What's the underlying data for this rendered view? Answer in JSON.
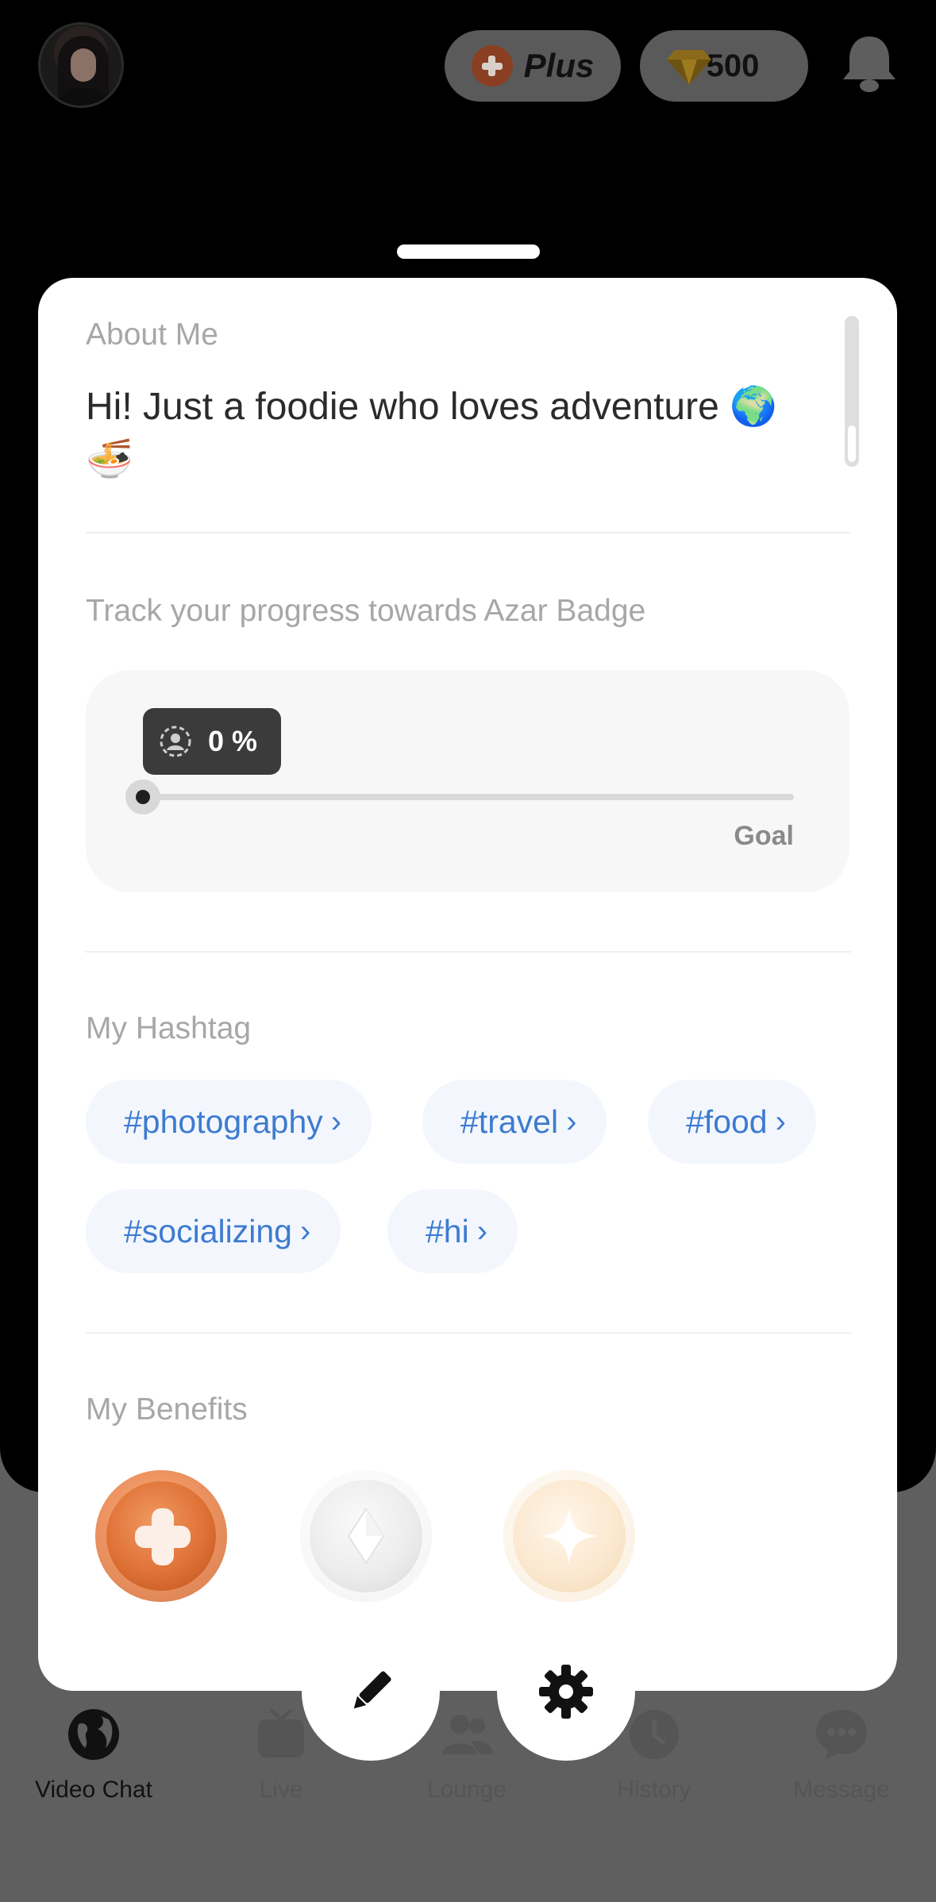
{
  "header": {
    "plus_label": "Plus",
    "gem_count": "500"
  },
  "about": {
    "section_label": "About Me",
    "text": "Hi! Just a foodie who loves adventure 🌍 🍜"
  },
  "progress": {
    "section_label": "Track your progress towards Azar Badge",
    "percent_label": "0 %",
    "value": 0,
    "goal_label": "Goal"
  },
  "hashtags": {
    "section_label": "My Hashtag",
    "items": [
      "#photography",
      "#travel",
      "#food",
      "#socializing",
      "#hi"
    ]
  },
  "benefits": {
    "section_label": "My Benefits"
  },
  "nav": {
    "items": [
      "Video Chat",
      "Live",
      "Lounge",
      "History",
      "Message"
    ]
  },
  "colors": {
    "hashtag_text": "#3d7bd0",
    "hashtag_bg": "#f3f7fd",
    "plus_orange": "#e07338"
  }
}
